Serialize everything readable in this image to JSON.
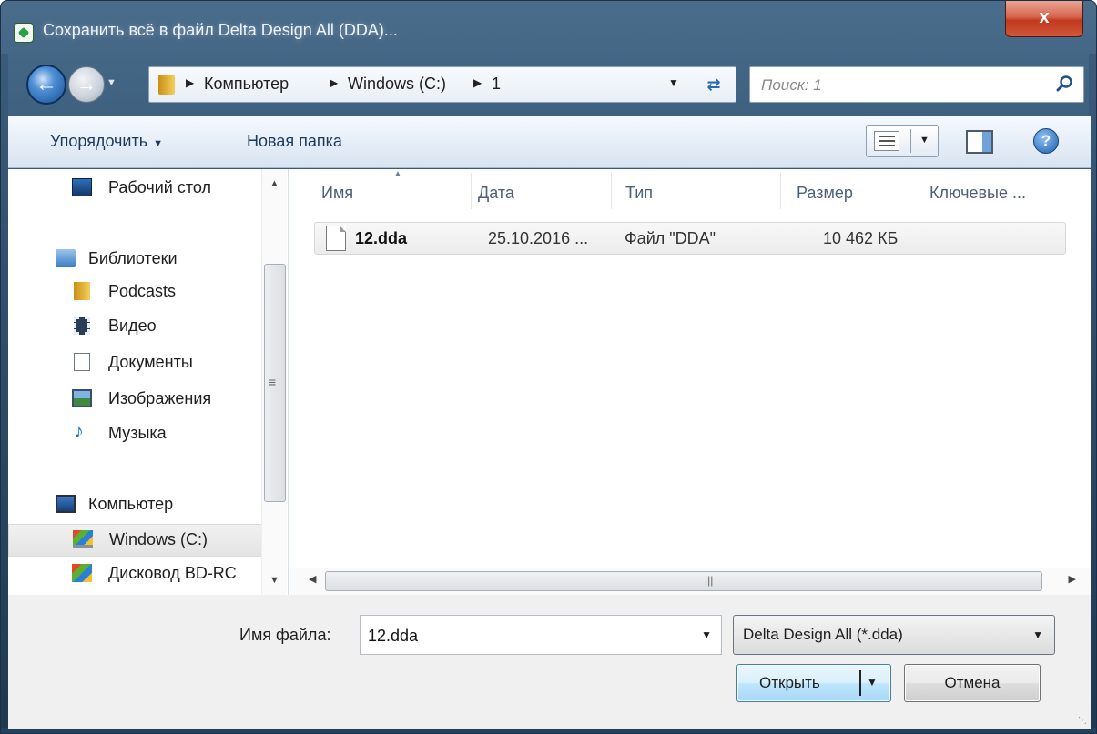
{
  "window": {
    "title": "Сохранить всё в файл Delta Design All (DDA)...",
    "close_label": "x"
  },
  "address": {
    "crumbs": [
      "Компьютер",
      "Windows (C:)",
      "1"
    ],
    "search_placeholder": "Поиск: 1"
  },
  "toolbar": {
    "organize_label": "Упорядочить",
    "new_folder_label": "Новая папка"
  },
  "nav": {
    "items": [
      {
        "label": "Рабочий стол",
        "icon": "desktop-icon"
      },
      {
        "label": "Библиотеки",
        "icon": "libraries-icon"
      },
      {
        "label": "Podcasts",
        "icon": "folder-icon"
      },
      {
        "label": "Видео",
        "icon": "video-icon"
      },
      {
        "label": "Документы",
        "icon": "document-icon"
      },
      {
        "label": "Изображения",
        "icon": "pictures-icon"
      },
      {
        "label": "Музыка",
        "icon": "music-icon"
      },
      {
        "label": "Компьютер",
        "icon": "computer-icon"
      },
      {
        "label": "Windows (C:)",
        "icon": "drive-icon",
        "selected": true
      },
      {
        "label": "Дисковод BD-RC",
        "icon": "optical-drive-icon"
      }
    ]
  },
  "files": {
    "columns": [
      "Имя",
      "Дата",
      "Тип",
      "Размер",
      "Ключевые ..."
    ],
    "rows": [
      {
        "name": "12.dda",
        "date": "25.10.2016 ...",
        "type": "Файл \"DDA\"",
        "size": "10 462 КБ"
      }
    ]
  },
  "bottom": {
    "filename_label": "Имя файла:",
    "filename_value": "12.dda",
    "filetype_value": "Delta Design All (*.dda)",
    "open_label": "Открыть",
    "cancel_label": "Отмена"
  }
}
